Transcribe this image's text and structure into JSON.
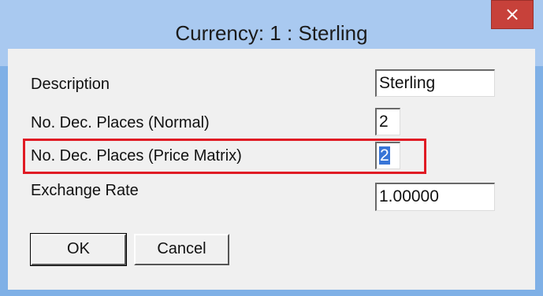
{
  "window": {
    "title": "Currency: 1 : Sterling",
    "close_label": "×"
  },
  "form": {
    "description_label": "Description",
    "description_value": "Sterling",
    "dec_normal_label": "No. Dec. Places (Normal)",
    "dec_normal_value": "2",
    "dec_price_matrix_label": "No. Dec. Places (Price Matrix)",
    "dec_price_matrix_value": "2",
    "exchange_rate_label": "Exchange Rate",
    "exchange_rate_value": "1.00000"
  },
  "buttons": {
    "ok_label": "OK",
    "cancel_label": "Cancel"
  },
  "colors": {
    "highlight_border": "#e01b24",
    "selection": "#3875d7",
    "close_button": "#c7413a",
    "titlebar": "#a9c9f0"
  }
}
